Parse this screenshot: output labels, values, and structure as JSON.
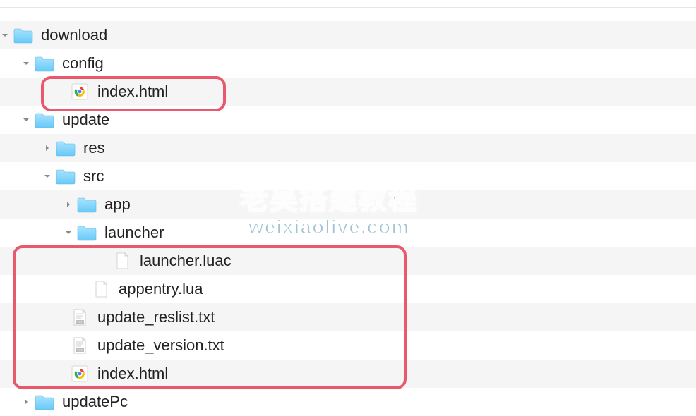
{
  "watermark": {
    "line1": "老吴搭建教程",
    "line2": "weixiaolive.com"
  },
  "tree": [
    {
      "indent": 0,
      "disclosure": "down",
      "icon": "folder",
      "label": "download",
      "stripe": true,
      "interactable": true
    },
    {
      "indent": 30,
      "disclosure": "down",
      "icon": "folder",
      "label": "config",
      "stripe": false,
      "interactable": true
    },
    {
      "indent": 80,
      "disclosure": "none",
      "icon": "chrome",
      "label": "index.html",
      "stripe": true,
      "interactable": true
    },
    {
      "indent": 30,
      "disclosure": "down",
      "icon": "folder",
      "label": "update",
      "stripe": false,
      "interactable": true
    },
    {
      "indent": 60,
      "disclosure": "right",
      "icon": "folder",
      "label": "res",
      "stripe": true,
      "interactable": true
    },
    {
      "indent": 60,
      "disclosure": "down",
      "icon": "folder",
      "label": "src",
      "stripe": false,
      "interactable": true
    },
    {
      "indent": 90,
      "disclosure": "right",
      "icon": "folder",
      "label": "app",
      "stripe": true,
      "interactable": true
    },
    {
      "indent": 90,
      "disclosure": "down",
      "icon": "folder",
      "label": "launcher",
      "stripe": false,
      "interactable": true
    },
    {
      "indent": 140,
      "disclosure": "none",
      "icon": "file",
      "label": "launcher.luac",
      "stripe": true,
      "interactable": true
    },
    {
      "indent": 110,
      "disclosure": "none",
      "icon": "file",
      "label": "appentry.lua",
      "stripe": false,
      "interactable": true
    },
    {
      "indent": 80,
      "disclosure": "none",
      "icon": "txt",
      "label": "update_reslist.txt",
      "stripe": true,
      "interactable": true
    },
    {
      "indent": 80,
      "disclosure": "none",
      "icon": "txt",
      "label": "update_version.txt",
      "stripe": false,
      "interactable": true
    },
    {
      "indent": 80,
      "disclosure": "none",
      "icon": "chrome",
      "label": "index.html",
      "stripe": true,
      "interactable": true
    },
    {
      "indent": 30,
      "disclosure": "right",
      "icon": "folder",
      "label": "updatePc",
      "stripe": false,
      "interactable": true
    }
  ]
}
